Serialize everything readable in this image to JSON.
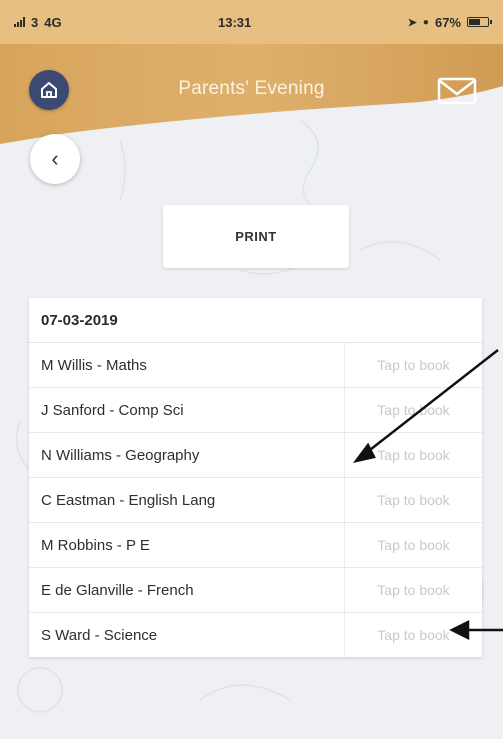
{
  "status_bar": {
    "carrier": "3",
    "network": "4G",
    "time": "13:31",
    "battery": "67%",
    "battery_level": 0.67
  },
  "header": {
    "title": "Parents' Evening",
    "home_icon": "home-icon",
    "mail_icon": "mail-icon"
  },
  "back_icon": "chevron-left-icon",
  "back_glyph": "‹",
  "print_label": "PRINT",
  "schedule": {
    "date": "07-03-2019",
    "rows": [
      {
        "name": "M Willis - Maths",
        "action": "Tap to book"
      },
      {
        "name": "J Sanford - Comp Sci",
        "action": "Tap to book"
      },
      {
        "name": "N Williams - Geography",
        "action": "Tap to book"
      },
      {
        "name": "C Eastman - English Lang",
        "action": "Tap to book"
      },
      {
        "name": "M Robbins - P E",
        "action": "Tap to book"
      },
      {
        "name": "E de Glanville - French",
        "action": "Tap to book"
      },
      {
        "name": "S Ward - Science",
        "action": "Tap to book"
      }
    ]
  },
  "colors": {
    "header": "#d9a55e",
    "home_button": "#3a4a72",
    "action_text": "#c6c9cf"
  }
}
